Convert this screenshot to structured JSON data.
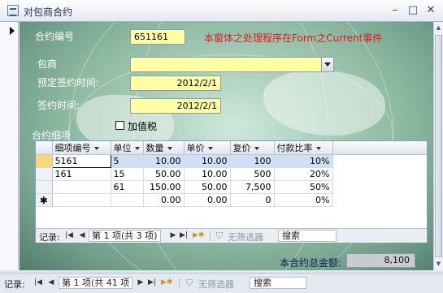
{
  "window": {
    "title": "对包商合约"
  },
  "form": {
    "contract_no_label": "合约编号",
    "contract_no_value": "651161",
    "note": "本窗体之处理程序在Form之Current事件",
    "contractor_label": "包商",
    "contractor_value": "",
    "planned_date_label": "预定签约时间:",
    "planned_date_value": "2012/2/1",
    "sign_date_label": "签约时间:",
    "sign_date_value": "2012/2/1",
    "vat_label": "加值税",
    "vat_checked": false,
    "details_label": "合约细项",
    "total_label": "本合约总金额:",
    "total_value": "8,100"
  },
  "subform": {
    "columns": [
      "细项编号",
      "单位",
      "数量",
      "单价",
      "复价",
      "付款比率"
    ],
    "rows": [
      {
        "selector": "",
        "cells": [
          "5161",
          "5",
          "10.00",
          "10.00",
          "100",
          "10%"
        ],
        "selected": true
      },
      {
        "selector": "",
        "cells": [
          "161",
          "15",
          "50.00",
          "10.00",
          "500",
          "20%"
        ]
      },
      {
        "selector": "",
        "cells": [
          "",
          "61",
          "150.00",
          "50.00",
          "7,500",
          "50%"
        ]
      },
      {
        "selector": "✱",
        "cells": [
          "",
          "",
          "0.00",
          "0.00",
          "0",
          "0%"
        ]
      }
    ],
    "nav": {
      "record_label": "记录:",
      "position": "第 1 项(共 3 项)",
      "filter": "无筛选器",
      "search": "搜索"
    }
  },
  "main_nav": {
    "record_label": "记录:",
    "position": "第 1 项(共 41 项",
    "filter": "无筛选器",
    "search": "搜索"
  }
}
